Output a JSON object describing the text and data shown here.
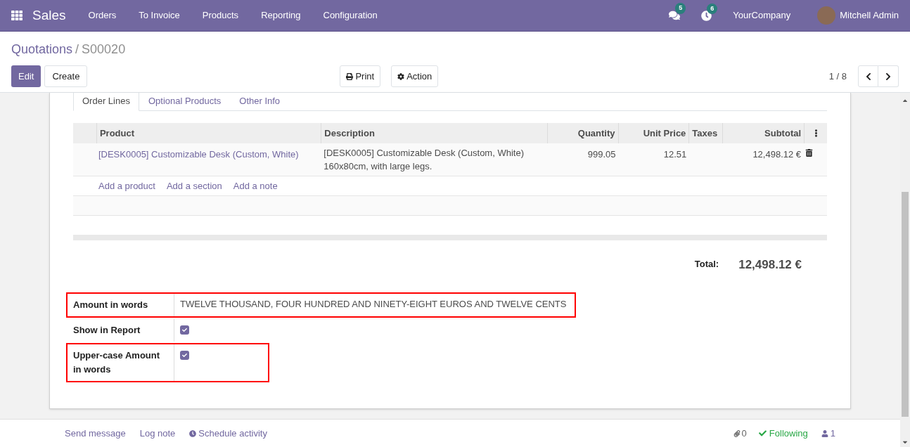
{
  "navbar": {
    "app": "Sales",
    "menu": [
      "Orders",
      "To Invoice",
      "Products",
      "Reporting",
      "Configuration"
    ],
    "messages_count": "5",
    "activities_count": "6",
    "company": "YourCompany",
    "user": "Mitchell Admin"
  },
  "breadcrumb": {
    "parent": "Quotations",
    "separator": "/",
    "current": "S00020"
  },
  "buttons": {
    "edit": "Edit",
    "create": "Create",
    "print": "Print",
    "action": "Action"
  },
  "pager": "1 / 8",
  "tabs": [
    {
      "label": "Order Lines",
      "selected": true
    },
    {
      "label": "Optional Products",
      "selected": false
    },
    {
      "label": "Other Info",
      "selected": false
    }
  ],
  "table": {
    "columns": [
      "Product",
      "Description",
      "Quantity",
      "Unit Price",
      "Taxes",
      "Subtotal"
    ],
    "rows": [
      {
        "product": "[DESK0005] Customizable Desk (Custom, White)",
        "description": [
          "[DESK0005] Customizable Desk (Custom, White)",
          "160x80cm, with large legs."
        ],
        "quantity": "999.05",
        "unit_price": "12.51",
        "subtotal": "12,498.12 €"
      }
    ],
    "add_links": [
      "Add a product",
      "Add a section",
      "Add a note"
    ]
  },
  "total": {
    "label": "Total:",
    "value": "12,498.12 €"
  },
  "fields": [
    {
      "kind": "text",
      "label": "Amount in words",
      "value": "TWELVE THOUSAND, FOUR HUNDRED AND NINETY-EIGHT EUROS AND TWELVE CENTS",
      "highlighted": true
    },
    {
      "kind": "checkbox",
      "label": "Show in Report",
      "checked": true,
      "highlighted": false
    },
    {
      "kind": "checkbox",
      "label": "Upper-case Amount in words",
      "checked": true,
      "highlighted": true
    }
  ],
  "chatter": {
    "actions": [
      "Send message",
      "Log note",
      "Schedule activity"
    ],
    "attachments": "0",
    "follow": "Following",
    "followers": "1"
  }
}
